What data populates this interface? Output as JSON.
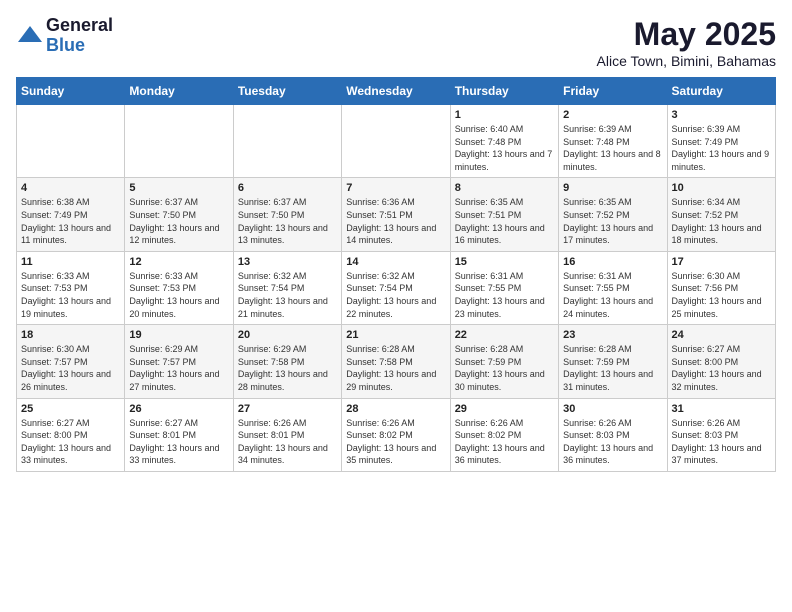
{
  "header": {
    "logo_general": "General",
    "logo_blue": "Blue",
    "month_title": "May 2025",
    "location": "Alice Town, Bimini, Bahamas"
  },
  "weekdays": [
    "Sunday",
    "Monday",
    "Tuesday",
    "Wednesday",
    "Thursday",
    "Friday",
    "Saturday"
  ],
  "weeks": [
    [
      {
        "day": "",
        "info": ""
      },
      {
        "day": "",
        "info": ""
      },
      {
        "day": "",
        "info": ""
      },
      {
        "day": "",
        "info": ""
      },
      {
        "day": "1",
        "info": "Sunrise: 6:40 AM\nSunset: 7:48 PM\nDaylight: 13 hours\nand 7 minutes."
      },
      {
        "day": "2",
        "info": "Sunrise: 6:39 AM\nSunset: 7:48 PM\nDaylight: 13 hours\nand 8 minutes."
      },
      {
        "day": "3",
        "info": "Sunrise: 6:39 AM\nSunset: 7:49 PM\nDaylight: 13 hours\nand 9 minutes."
      }
    ],
    [
      {
        "day": "4",
        "info": "Sunrise: 6:38 AM\nSunset: 7:49 PM\nDaylight: 13 hours\nand 11 minutes."
      },
      {
        "day": "5",
        "info": "Sunrise: 6:37 AM\nSunset: 7:50 PM\nDaylight: 13 hours\nand 12 minutes."
      },
      {
        "day": "6",
        "info": "Sunrise: 6:37 AM\nSunset: 7:50 PM\nDaylight: 13 hours\nand 13 minutes."
      },
      {
        "day": "7",
        "info": "Sunrise: 6:36 AM\nSunset: 7:51 PM\nDaylight: 13 hours\nand 14 minutes."
      },
      {
        "day": "8",
        "info": "Sunrise: 6:35 AM\nSunset: 7:51 PM\nDaylight: 13 hours\nand 16 minutes."
      },
      {
        "day": "9",
        "info": "Sunrise: 6:35 AM\nSunset: 7:52 PM\nDaylight: 13 hours\nand 17 minutes."
      },
      {
        "day": "10",
        "info": "Sunrise: 6:34 AM\nSunset: 7:52 PM\nDaylight: 13 hours\nand 18 minutes."
      }
    ],
    [
      {
        "day": "11",
        "info": "Sunrise: 6:33 AM\nSunset: 7:53 PM\nDaylight: 13 hours\nand 19 minutes."
      },
      {
        "day": "12",
        "info": "Sunrise: 6:33 AM\nSunset: 7:53 PM\nDaylight: 13 hours\nand 20 minutes."
      },
      {
        "day": "13",
        "info": "Sunrise: 6:32 AM\nSunset: 7:54 PM\nDaylight: 13 hours\nand 21 minutes."
      },
      {
        "day": "14",
        "info": "Sunrise: 6:32 AM\nSunset: 7:54 PM\nDaylight: 13 hours\nand 22 minutes."
      },
      {
        "day": "15",
        "info": "Sunrise: 6:31 AM\nSunset: 7:55 PM\nDaylight: 13 hours\nand 23 minutes."
      },
      {
        "day": "16",
        "info": "Sunrise: 6:31 AM\nSunset: 7:55 PM\nDaylight: 13 hours\nand 24 minutes."
      },
      {
        "day": "17",
        "info": "Sunrise: 6:30 AM\nSunset: 7:56 PM\nDaylight: 13 hours\nand 25 minutes."
      }
    ],
    [
      {
        "day": "18",
        "info": "Sunrise: 6:30 AM\nSunset: 7:57 PM\nDaylight: 13 hours\nand 26 minutes."
      },
      {
        "day": "19",
        "info": "Sunrise: 6:29 AM\nSunset: 7:57 PM\nDaylight: 13 hours\nand 27 minutes."
      },
      {
        "day": "20",
        "info": "Sunrise: 6:29 AM\nSunset: 7:58 PM\nDaylight: 13 hours\nand 28 minutes."
      },
      {
        "day": "21",
        "info": "Sunrise: 6:28 AM\nSunset: 7:58 PM\nDaylight: 13 hours\nand 29 minutes."
      },
      {
        "day": "22",
        "info": "Sunrise: 6:28 AM\nSunset: 7:59 PM\nDaylight: 13 hours\nand 30 minutes."
      },
      {
        "day": "23",
        "info": "Sunrise: 6:28 AM\nSunset: 7:59 PM\nDaylight: 13 hours\nand 31 minutes."
      },
      {
        "day": "24",
        "info": "Sunrise: 6:27 AM\nSunset: 8:00 PM\nDaylight: 13 hours\nand 32 minutes."
      }
    ],
    [
      {
        "day": "25",
        "info": "Sunrise: 6:27 AM\nSunset: 8:00 PM\nDaylight: 13 hours\nand 33 minutes."
      },
      {
        "day": "26",
        "info": "Sunrise: 6:27 AM\nSunset: 8:01 PM\nDaylight: 13 hours\nand 33 minutes."
      },
      {
        "day": "27",
        "info": "Sunrise: 6:26 AM\nSunset: 8:01 PM\nDaylight: 13 hours\nand 34 minutes."
      },
      {
        "day": "28",
        "info": "Sunrise: 6:26 AM\nSunset: 8:02 PM\nDaylight: 13 hours\nand 35 minutes."
      },
      {
        "day": "29",
        "info": "Sunrise: 6:26 AM\nSunset: 8:02 PM\nDaylight: 13 hours\nand 36 minutes."
      },
      {
        "day": "30",
        "info": "Sunrise: 6:26 AM\nSunset: 8:03 PM\nDaylight: 13 hours\nand 36 minutes."
      },
      {
        "day": "31",
        "info": "Sunrise: 6:26 AM\nSunset: 8:03 PM\nDaylight: 13 hours\nand 37 minutes."
      }
    ]
  ]
}
